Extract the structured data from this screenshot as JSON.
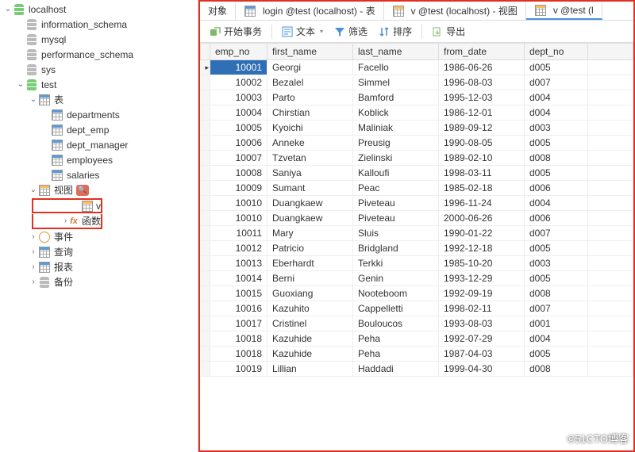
{
  "sidebar": {
    "root": "localhost",
    "schemas": [
      "information_schema",
      "mysql",
      "performance_schema",
      "sys",
      "test"
    ],
    "test": {
      "tables_label": "表",
      "tables": [
        "departments",
        "dept_emp",
        "dept_manager",
        "employees",
        "salaries"
      ],
      "views_label": "视图",
      "views": [
        "v"
      ],
      "functions_label": "函数",
      "events_label": "事件",
      "queries_label": "查询",
      "reports_label": "报表",
      "backup_label": "备份"
    }
  },
  "tabs": {
    "objects": "对象",
    "login": "login @test (localhost) - 表",
    "view1": "v @test (localhost) - 视图",
    "view2": "v @test (l"
  },
  "toolbar": {
    "begin_tx": "开始事务",
    "text": "文本",
    "filter": "筛选",
    "sort": "排序",
    "export": "导出"
  },
  "columns": [
    "emp_no",
    "first_name",
    "last_name",
    "from_date",
    "dept_no"
  ],
  "rows": [
    {
      "emp_no": 10001,
      "first_name": "Georgi",
      "last_name": "Facello",
      "from_date": "1986-06-26",
      "dept_no": "d005",
      "sel": true
    },
    {
      "emp_no": 10002,
      "first_name": "Bezalel",
      "last_name": "Simmel",
      "from_date": "1996-08-03",
      "dept_no": "d007"
    },
    {
      "emp_no": 10003,
      "first_name": "Parto",
      "last_name": "Bamford",
      "from_date": "1995-12-03",
      "dept_no": "d004"
    },
    {
      "emp_no": 10004,
      "first_name": "Chirstian",
      "last_name": "Koblick",
      "from_date": "1986-12-01",
      "dept_no": "d004"
    },
    {
      "emp_no": 10005,
      "first_name": "Kyoichi",
      "last_name": "Maliniak",
      "from_date": "1989-09-12",
      "dept_no": "d003"
    },
    {
      "emp_no": 10006,
      "first_name": "Anneke",
      "last_name": "Preusig",
      "from_date": "1990-08-05",
      "dept_no": "d005"
    },
    {
      "emp_no": 10007,
      "first_name": "Tzvetan",
      "last_name": "Zielinski",
      "from_date": "1989-02-10",
      "dept_no": "d008"
    },
    {
      "emp_no": 10008,
      "first_name": "Saniya",
      "last_name": "Kalloufi",
      "from_date": "1998-03-11",
      "dept_no": "d005"
    },
    {
      "emp_no": 10009,
      "first_name": "Sumant",
      "last_name": "Peac",
      "from_date": "1985-02-18",
      "dept_no": "d006"
    },
    {
      "emp_no": 10010,
      "first_name": "Duangkaew",
      "last_name": "Piveteau",
      "from_date": "1996-11-24",
      "dept_no": "d004"
    },
    {
      "emp_no": 10010,
      "first_name": "Duangkaew",
      "last_name": "Piveteau",
      "from_date": "2000-06-26",
      "dept_no": "d006"
    },
    {
      "emp_no": 10011,
      "first_name": "Mary",
      "last_name": "Sluis",
      "from_date": "1990-01-22",
      "dept_no": "d007"
    },
    {
      "emp_no": 10012,
      "first_name": "Patricio",
      "last_name": "Bridgland",
      "from_date": "1992-12-18",
      "dept_no": "d005"
    },
    {
      "emp_no": 10013,
      "first_name": "Eberhardt",
      "last_name": "Terkki",
      "from_date": "1985-10-20",
      "dept_no": "d003"
    },
    {
      "emp_no": 10014,
      "first_name": "Berni",
      "last_name": "Genin",
      "from_date": "1993-12-29",
      "dept_no": "d005"
    },
    {
      "emp_no": 10015,
      "first_name": "Guoxiang",
      "last_name": "Nooteboom",
      "from_date": "1992-09-19",
      "dept_no": "d008"
    },
    {
      "emp_no": 10016,
      "first_name": "Kazuhito",
      "last_name": "Cappelletti",
      "from_date": "1998-02-11",
      "dept_no": "d007"
    },
    {
      "emp_no": 10017,
      "first_name": "Cristinel",
      "last_name": "Bouloucos",
      "from_date": "1993-08-03",
      "dept_no": "d001"
    },
    {
      "emp_no": 10018,
      "first_name": "Kazuhide",
      "last_name": "Peha",
      "from_date": "1992-07-29",
      "dept_no": "d004"
    },
    {
      "emp_no": 10018,
      "first_name": "Kazuhide",
      "last_name": "Peha",
      "from_date": "1987-04-03",
      "dept_no": "d005"
    },
    {
      "emp_no": 10019,
      "first_name": "Lillian",
      "last_name": "Haddadi",
      "from_date": "1999-04-30",
      "dept_no": "d008"
    }
  ],
  "watermark": "©51CTO博客"
}
